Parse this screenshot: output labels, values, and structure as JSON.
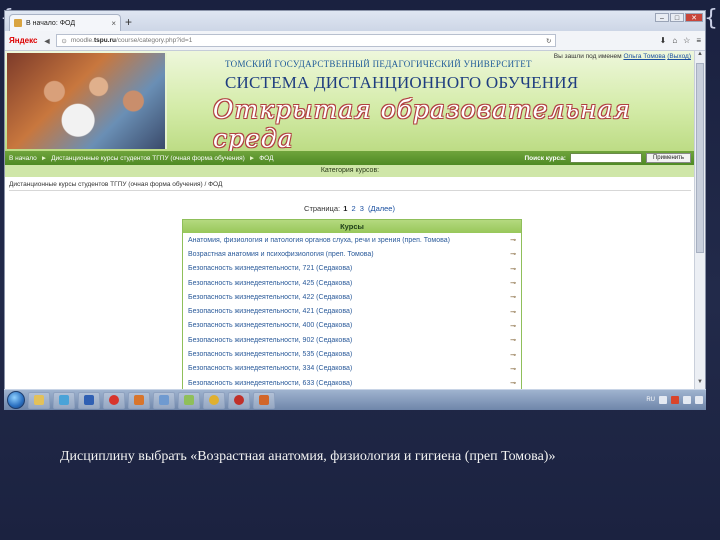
{
  "browser": {
    "tab_title": "В начало: ФОД",
    "new_tab_symbol": "+",
    "search_engine_logo": "Яндекс",
    "url_prefix": "moodle.",
    "url_host": "tspu.ru",
    "url_path": "/course/category.php?id=1",
    "window_controls": [
      "–",
      "□",
      "✕"
    ]
  },
  "site": {
    "login_info": "Вы зашли под именем",
    "login_user": "Ольга Томова",
    "logout_link": "(Выход)",
    "university_name": "ТОМСКИЙ ГОСУДАРСТВЕННЫЙ ПЕДАГОГИЧЕСКИЙ УНИВЕРСИТЕТ",
    "system_title": "СИСТЕМА ДИСТАНЦИОННОГО ОБУЧЕНИЯ",
    "slogan": "Открытая образовательная среда"
  },
  "breadcrumb": {
    "home": "В начало",
    "category": "Дистанционные курсы студентов ТГПУ (очная форма обучения)",
    "current": "ФОД",
    "separator": "►"
  },
  "search": {
    "label": "Поиск курса:",
    "button": "Применить"
  },
  "category_bar": "Категория курсов:",
  "subcrumb": {
    "category": "Дистанционные курсы студентов ТГПУ (очная форма обучения)",
    "current": "ФОД"
  },
  "pager": {
    "label": "Страница:",
    "pages": [
      "1",
      "2",
      "3"
    ],
    "current": "1",
    "next": "(Далее)"
  },
  "courses": {
    "header": "Курсы",
    "items": [
      "Анатомия, физиология и патология органов слуха, речи и зрения (преп. Томова)",
      "Возрастная анатомия и психофизиология (преп. Томова)",
      "Безопасность жизнедеятельности, 721 (Седакова)",
      "Безопасность жизнедеятельности, 425 (Седакова)",
      "Безопасность жизнедеятельности, 422 (Седакова)",
      "Безопасность жизнедеятельности, 421 (Седакова)",
      "Безопасность жизнедеятельности, 400 (Седакова)",
      "Безопасность жизнедеятельности, 902 (Седакова)",
      "Безопасность жизнедеятельности, 535 (Седакова)",
      "Безопасность жизнедеятельности, 334 (Седакова)",
      "Безопасность жизнедеятельности, 633 (Седакова)"
    ]
  },
  "taskbar": {
    "tray_language": "RU"
  },
  "caption": "Дисциплину выбрать «Возрастная анатомия, физиология и гигиена (преп Томова)»"
}
